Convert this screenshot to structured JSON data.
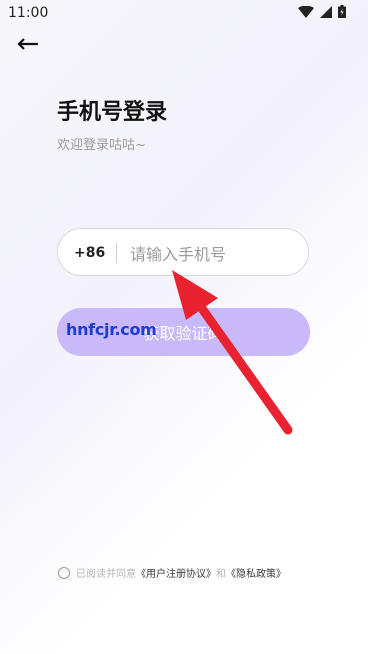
{
  "status_bar": {
    "time": "11:00"
  },
  "header": {
    "title": "手机号登录",
    "subtitle": "欢迎登录咕咕~"
  },
  "phone": {
    "country_code": "+86",
    "placeholder": "请输入手机号"
  },
  "actions": {
    "get_code_label": "获取验证码"
  },
  "watermark": {
    "text": "hnfcjr.com"
  },
  "agreement": {
    "prefix": "已阅读并同意",
    "user_agreement": "《用户注册协议》",
    "and": "和",
    "privacy_policy": "《隐私政策》"
  },
  "colors": {
    "primary_button": "#c9b8fa",
    "watermark": "#1e3bd6",
    "annotation_arrow": "#e8222f"
  }
}
